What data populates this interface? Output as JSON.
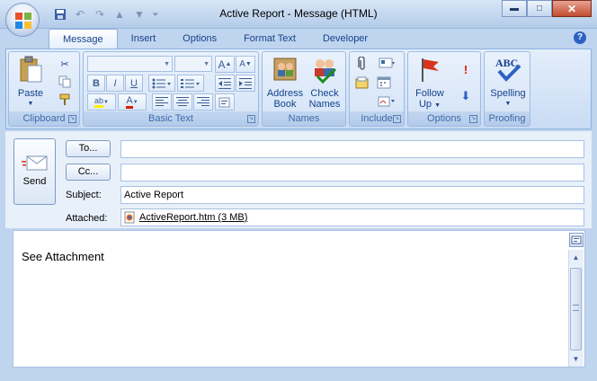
{
  "window": {
    "title": "Active Report - Message (HTML)",
    "minimize_glyph": "▬",
    "maximize_glyph": "□",
    "close_glyph": "✕"
  },
  "quick_access": {
    "save_icon": "save-icon",
    "undo_icon": "undo-icon",
    "redo_icon": "redo-icon",
    "up_icon": "up-arrow-icon",
    "down_icon": "down-arrow-icon",
    "customize_icon": "customize-qat-icon"
  },
  "tabs": [
    "Message",
    "Insert",
    "Options",
    "Format Text",
    "Developer"
  ],
  "help_glyph": "?",
  "ribbon": {
    "clipboard": {
      "label": "Clipboard",
      "paste": "Paste"
    },
    "basic_text": {
      "label": "Basic Text",
      "bold": "B",
      "italic": "I",
      "underline": "U",
      "grow": "A",
      "shrink": "A",
      "highlight": "ab",
      "font_color": "A"
    },
    "names": {
      "label": "Names",
      "address_book_1": "Address",
      "address_book_2": "Book",
      "check_names_1": "Check",
      "check_names_2": "Names"
    },
    "include": {
      "label": "Include"
    },
    "options": {
      "label": "Options",
      "follow_up_1": "Follow",
      "follow_up_2": "Up",
      "importance_high": "!"
    },
    "proofing": {
      "label": "Proofing",
      "spelling": "Spelling",
      "spelling_icon_text": "ABC"
    }
  },
  "header": {
    "send": "Send",
    "to_button": "To...",
    "cc_button": "Cc...",
    "to_value": "",
    "cc_value": "",
    "subject_label": "Subject:",
    "subject_value": "Active Report",
    "attached_label": "Attached:",
    "attachment": "ActiveReport.htm (3 MB)"
  },
  "body": {
    "text": "See Attachment"
  },
  "colors": {
    "accent": "#15428b",
    "ribbon_bg": "#d3e3f7",
    "frame": "#bfd4ee"
  }
}
